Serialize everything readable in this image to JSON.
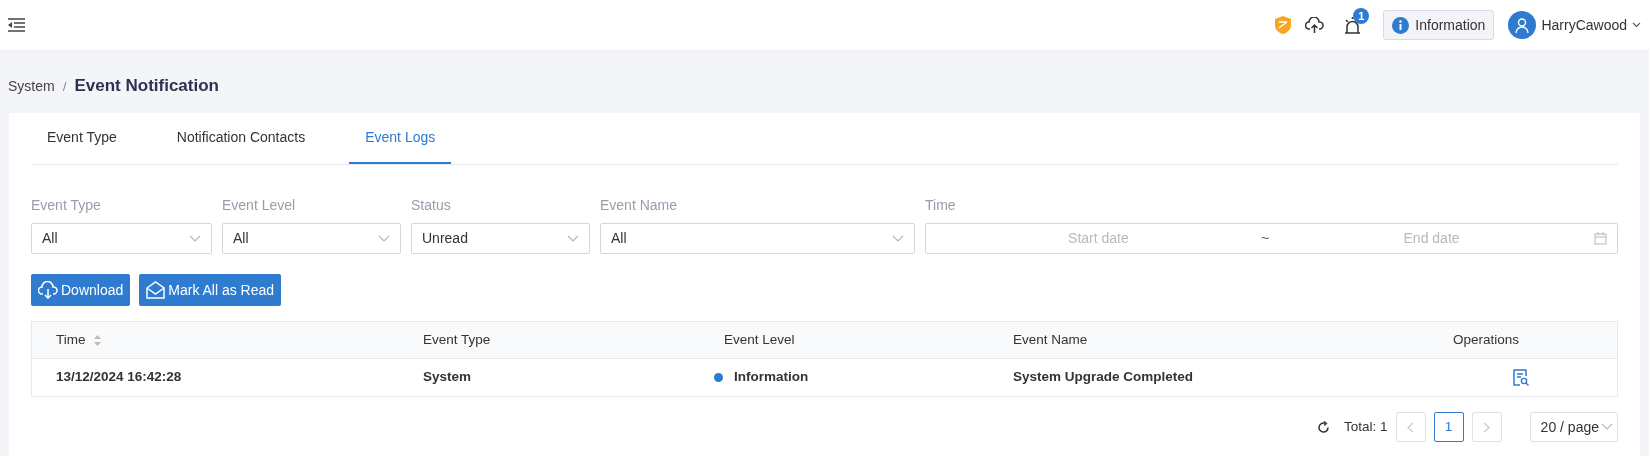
{
  "header": {
    "notification_count": "1",
    "info_button": "Information",
    "user": "HarryCawood"
  },
  "breadcrumb": {
    "parent": "System",
    "separator": "/",
    "current": "Event Notification"
  },
  "tabs": [
    {
      "label": "Event Type",
      "selected": false
    },
    {
      "label": "Notification Contacts",
      "selected": false
    },
    {
      "label": "Event Logs",
      "selected": true
    }
  ],
  "filters": [
    {
      "label": "Event Type",
      "value": "All"
    },
    {
      "label": "Event Level",
      "value": "All"
    },
    {
      "label": "Status",
      "value": "Unread"
    },
    {
      "label": "Event Name",
      "value": "All"
    }
  ],
  "time_filter": {
    "label": "Time",
    "start_placeholder": "Start date",
    "separator": "~",
    "end_placeholder": "End date"
  },
  "buttons": [
    "Download",
    "Mark All as Read"
  ],
  "table": {
    "columns": [
      "Time",
      "Event Type",
      "Event Level",
      "Event Name",
      "Operations"
    ],
    "rows": [
      {
        "time": "13/12/2024 16:42:28",
        "event_type": "System",
        "event_level": "Information",
        "color": "#2e7bcf",
        "event_name": "System Upgrade Completed"
      }
    ]
  },
  "pagination": {
    "total": "Total: 1",
    "pages": [
      {
        "label": "1",
        "selected": true
      }
    ],
    "prev_disabled": true,
    "next_disabled": true,
    "page_size": "20 / page"
  }
}
